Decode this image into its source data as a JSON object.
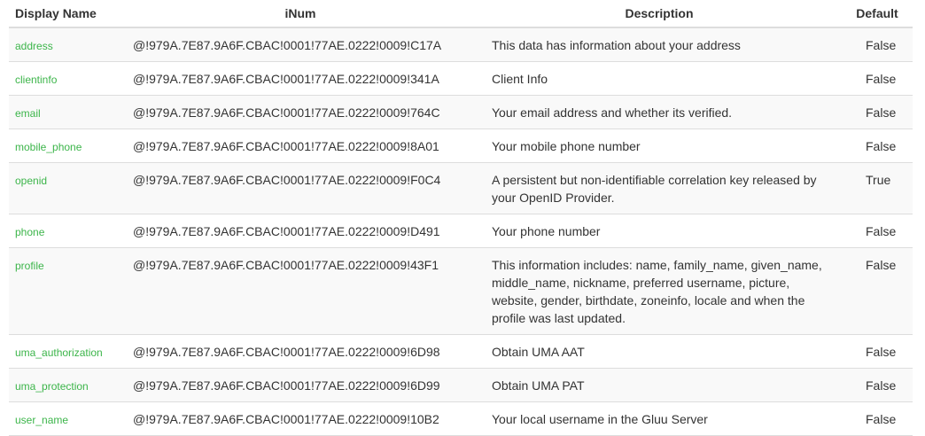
{
  "table": {
    "headers": {
      "display_name": "Display Name",
      "inum": "iNum",
      "description": "Description",
      "default": "Default"
    },
    "rows": [
      {
        "name": "address",
        "inum": "@!979A.7E87.9A6F.CBAC!0001!77AE.0222!0009!C17A",
        "description": "This data has information about your address",
        "default": "False"
      },
      {
        "name": "clientinfo",
        "inum": "@!979A.7E87.9A6F.CBAC!0001!77AE.0222!0009!341A",
        "description": "Client Info",
        "default": "False"
      },
      {
        "name": "email",
        "inum": "@!979A.7E87.9A6F.CBAC!0001!77AE.0222!0009!764C",
        "description": "Your email address and whether its verified.",
        "default": "False"
      },
      {
        "name": "mobile_phone",
        "inum": "@!979A.7E87.9A6F.CBAC!0001!77AE.0222!0009!8A01",
        "description": "Your mobile phone number",
        "default": "False"
      },
      {
        "name": "openid",
        "inum": "@!979A.7E87.9A6F.CBAC!0001!77AE.0222!0009!F0C4",
        "description": "A persistent but non-identifiable correlation key released by your OpenID Provider.",
        "default": "True"
      },
      {
        "name": "phone",
        "inum": "@!979A.7E87.9A6F.CBAC!0001!77AE.0222!0009!D491",
        "description": "Your phone number",
        "default": "False"
      },
      {
        "name": "profile",
        "inum": "@!979A.7E87.9A6F.CBAC!0001!77AE.0222!0009!43F1",
        "description": "This information includes: name, family_name, given_name, middle_name, nickname, preferred username, picture, website, gender, birthdate, zoneinfo, locale and when the profile was last updated.",
        "default": "False"
      },
      {
        "name": "uma_authorization",
        "inum": "@!979A.7E87.9A6F.CBAC!0001!77AE.0222!0009!6D98",
        "description": "Obtain UMA AAT",
        "default": "False"
      },
      {
        "name": "uma_protection",
        "inum": "@!979A.7E87.9A6F.CBAC!0001!77AE.0222!0009!6D99",
        "description": "Obtain UMA PAT",
        "default": "False"
      },
      {
        "name": "user_name",
        "inum": "@!979A.7E87.9A6F.CBAC!0001!77AE.0222!0009!10B2",
        "description": "Your local username in the Gluu Server",
        "default": "False"
      }
    ]
  },
  "colors": {
    "link": "#3cb54a",
    "stripe": "#f9f9f9",
    "border": "#dddddd"
  }
}
